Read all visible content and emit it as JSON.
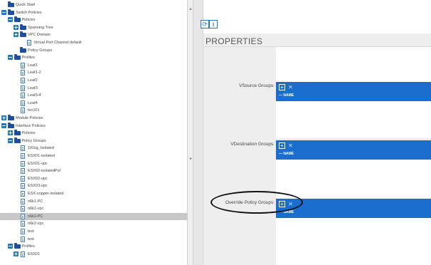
{
  "tree": {
    "items": [
      {
        "label": "Quick Start",
        "indent": 0,
        "icon": "folder-icon",
        "toggle": "none"
      },
      {
        "label": "Switch Policies",
        "indent": 0,
        "icon": "folder-icon",
        "toggle": "minus"
      },
      {
        "label": "Policies",
        "indent": 1,
        "icon": "folder-icon",
        "toggle": "minus"
      },
      {
        "label": "Spanning Tree",
        "indent": 2,
        "icon": "folder-icon",
        "toggle": "plus"
      },
      {
        "label": "VPC Domain",
        "indent": 2,
        "icon": "folder-icon",
        "toggle": "plus"
      },
      {
        "label": "Virtual Port Channel default",
        "indent": 3,
        "icon": "doc-icon",
        "toggle": "none"
      },
      {
        "label": "Policy Groups",
        "indent": 2,
        "icon": "folder-icon",
        "toggle": "none"
      },
      {
        "label": "Profiles",
        "indent": 1,
        "icon": "folder-icon",
        "toggle": "minus"
      },
      {
        "label": "Leaf1",
        "indent": 2,
        "icon": "doc-icon",
        "toggle": "none"
      },
      {
        "label": "Leaf1-2",
        "indent": 2,
        "icon": "doc-icon",
        "toggle": "none"
      },
      {
        "label": "Leaf2",
        "indent": 2,
        "icon": "doc-icon",
        "toggle": "none"
      },
      {
        "label": "Leaf3",
        "indent": 2,
        "icon": "doc-icon",
        "toggle": "none"
      },
      {
        "label": "Leaf3-4",
        "indent": 2,
        "icon": "doc-icon",
        "toggle": "none"
      },
      {
        "label": "Leaf4",
        "indent": 2,
        "icon": "doc-icon",
        "toggle": "none"
      },
      {
        "label": "fex101",
        "indent": 2,
        "icon": "doc-icon",
        "toggle": "none"
      },
      {
        "label": "Module Policies",
        "indent": 0,
        "icon": "folder-icon",
        "toggle": "plus"
      },
      {
        "label": "Interface Policies",
        "indent": 0,
        "icon": "folder-icon",
        "toggle": "minus"
      },
      {
        "label": "Policies",
        "indent": 1,
        "icon": "folder-icon",
        "toggle": "plus"
      },
      {
        "label": "Policy Groups",
        "indent": 1,
        "icon": "folder-icon",
        "toggle": "minus"
      },
      {
        "label": "10Gig_Isolated",
        "indent": 2,
        "icon": "doc-icon",
        "toggle": "none"
      },
      {
        "label": "ESX01-isolated",
        "indent": 2,
        "icon": "doc-icon",
        "toggle": "none"
      },
      {
        "label": "ESX01-vpc",
        "indent": 2,
        "icon": "doc-icon",
        "toggle": "none"
      },
      {
        "label": "ESX02-isolatedPol",
        "indent": 2,
        "icon": "doc-icon",
        "toggle": "none"
      },
      {
        "label": "ESX02-vpc",
        "indent": 2,
        "icon": "doc-icon",
        "toggle": "none"
      },
      {
        "label": "ESX03-vpc",
        "indent": 2,
        "icon": "doc-icon",
        "toggle": "none"
      },
      {
        "label": "ESX-copper-isolated",
        "indent": 2,
        "icon": "doc-icon",
        "toggle": "none"
      },
      {
        "label": "n6k1-PC",
        "indent": 2,
        "icon": "doc-icon",
        "toggle": "none"
      },
      {
        "label": "n6k1-vpc",
        "indent": 2,
        "icon": "doc-icon",
        "toggle": "none"
      },
      {
        "label": "n6k2-PC",
        "indent": 2,
        "icon": "doc-icon",
        "toggle": "none",
        "selected": true
      },
      {
        "label": "n6k2-vpc",
        "indent": 2,
        "icon": "doc-icon",
        "toggle": "none"
      },
      {
        "label": "test",
        "indent": 2,
        "icon": "doc-icon",
        "toggle": "none"
      },
      {
        "label": "test",
        "indent": 2,
        "icon": "doc-icon",
        "toggle": "none"
      },
      {
        "label": "Profiles",
        "indent": 1,
        "icon": "folder-icon",
        "toggle": "minus"
      },
      {
        "label": "ESX01",
        "indent": 2,
        "icon": "doc-icon",
        "toggle": "plus"
      }
    ]
  },
  "toolbar": {
    "refresh_icon": "refresh-icon",
    "download_icon": "download-icon"
  },
  "properties": {
    "title": "PROPERTIES",
    "groups": [
      {
        "label": "VSource Groups:",
        "column": "NAME"
      },
      {
        "label": "VDestination Groups:",
        "column": "NAME"
      },
      {
        "label": "Override Policy Groups:",
        "column": "NAME"
      }
    ]
  },
  "colors": {
    "accent": "#1a6fce",
    "selected_row": "#c8c8c8",
    "folder": "#1f4e9c"
  }
}
